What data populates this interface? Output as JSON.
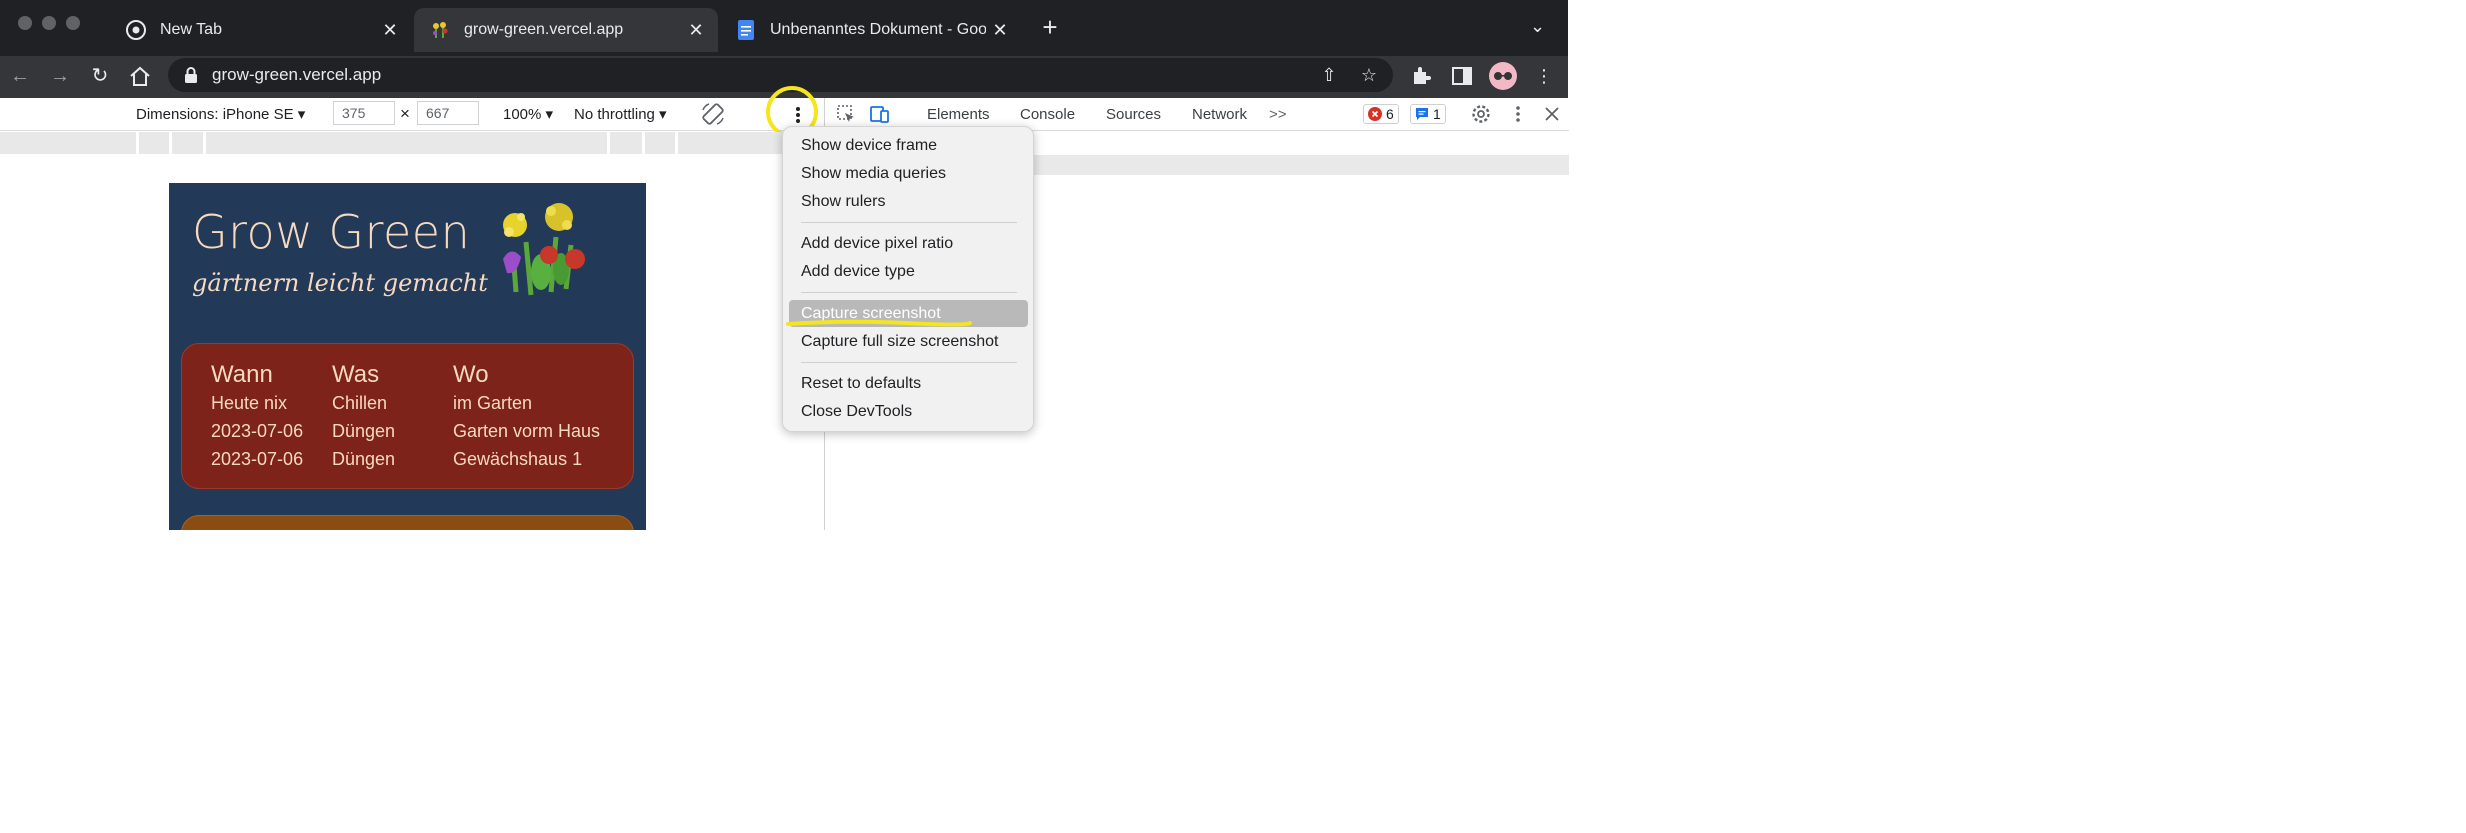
{
  "browser": {
    "tabs": [
      {
        "title": "New Tab",
        "icon": "chrome-icon"
      },
      {
        "title": "grow-green.vercel.app",
        "icon": "flowers-favicon",
        "active": true
      },
      {
        "title": "Unbenanntes Dokument - Goog",
        "icon": "google-docs-icon"
      }
    ],
    "address": "grow-green.vercel.app"
  },
  "device_toolbar": {
    "dimensions_label": "Dimensions: iPhone SE",
    "width": "375",
    "height": "667",
    "times": "×",
    "zoom": "100%",
    "throttling": "No throttling"
  },
  "devtools": {
    "tabs": [
      "Elements",
      "Console",
      "Sources",
      "Network"
    ],
    "more": ">>",
    "error_count": "6",
    "message_count": "1"
  },
  "page": {
    "title": "Grow Green",
    "subtitle": "gärtnern leicht gemacht",
    "table": {
      "headers": [
        "Wann",
        "Was",
        "Wo"
      ],
      "rows": [
        [
          "Heute nix",
          "Chillen",
          "im Garten"
        ],
        [
          "2023-07-06",
          "Düngen",
          "Garten vorm Haus"
        ],
        [
          "2023-07-06",
          "Düngen",
          "Gewächshaus 1"
        ]
      ]
    }
  },
  "context_menu": {
    "items": [
      "Show device frame",
      "Show media queries",
      "Show rulers",
      "Add device pixel ratio",
      "Add device type",
      "Capture screenshot",
      "Capture full size screenshot",
      "Reset to defaults",
      "Close DevTools"
    ],
    "highlighted": "Capture screenshot"
  },
  "colors": {
    "page_bg": "#223a57",
    "card_red": "#7e231a",
    "card_orange": "#8b4c13",
    "text_peach": "#f7d9bf",
    "annotation_yellow": "#f5e51d"
  }
}
